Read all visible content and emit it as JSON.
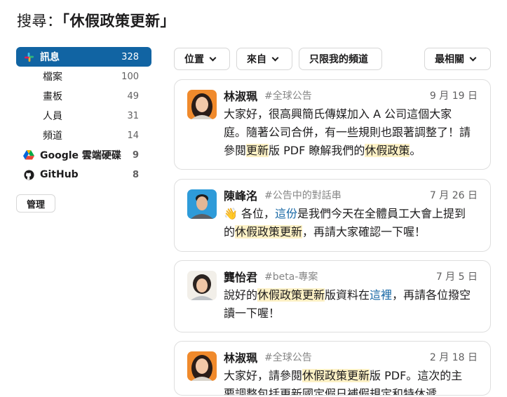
{
  "search": {
    "prefix": "搜尋：",
    "query": "「休假政策更新」"
  },
  "sidebar": {
    "main": {
      "label": "訊息",
      "count": "328"
    },
    "sub_items": [
      {
        "label": "檔案",
        "count": "100"
      },
      {
        "label": "畫板",
        "count": "49"
      },
      {
        "label": "人員",
        "count": "31"
      },
      {
        "label": "頻道",
        "count": "14"
      }
    ],
    "apps": [
      {
        "label": "Google 雲端硬碟",
        "count": "9",
        "icon": "google-drive-icon"
      },
      {
        "label": "GitHub",
        "count": "8",
        "icon": "github-icon"
      }
    ],
    "manage_label": "管理"
  },
  "filters": {
    "location": "位置",
    "from": "來自",
    "my_channels_only": "只限我的頻道",
    "sort": "最相關"
  },
  "results": [
    {
      "author": "林淑珮",
      "channel": "#全球公告",
      "date": "9 月 19 日",
      "segments": [
        {
          "t": "大家好，很高興簡氏傳媒加入 A 公司這個大家庭。隨著公司合併，有一些規則也跟著調整了！請參閱",
          "k": ""
        },
        {
          "t": "更新",
          "k": "hl"
        },
        {
          "t": "版 PDF 瞭解我們的",
          "k": ""
        },
        {
          "t": "休假政策",
          "k": "hl"
        },
        {
          "t": "。",
          "k": ""
        }
      ]
    },
    {
      "author": "陳峰洺",
      "channel": "#公告中的對話串",
      "date": "7 月 26 日",
      "segments": [
        {
          "t": "👋",
          "k": ""
        },
        {
          "t": " 各位，",
          "k": ""
        },
        {
          "t": "這份",
          "k": "link"
        },
        {
          "t": "是我們今天在全體員工大會上提到的",
          "k": ""
        },
        {
          "t": "休假政策更新",
          "k": "hl"
        },
        {
          "t": "，再請大家確認一下喔！",
          "k": ""
        }
      ]
    },
    {
      "author": "龔怡君",
      "channel": "#beta-專案",
      "date": "7 月 5 日",
      "segments": [
        {
          "t": "說好的",
          "k": ""
        },
        {
          "t": "休假政策更新",
          "k": "hl"
        },
        {
          "t": "版資料在",
          "k": ""
        },
        {
          "t": "這裡",
          "k": "link"
        },
        {
          "t": "，再請各位撥空讀一下喔！",
          "k": ""
        }
      ]
    },
    {
      "author": "林淑珮",
      "channel": "#全球公告",
      "date": "2 月 18 日",
      "segments": [
        {
          "t": "大家好，請參閱",
          "k": ""
        },
        {
          "t": "休假政策更新",
          "k": "hl"
        },
        {
          "t": "版 PDF。這次的主要調整包括更新國定假日補假規定和特休遞",
          "k": ""
        }
      ]
    }
  ],
  "colors": {
    "accent": "#1164a3",
    "highlight": "#fdf1c5",
    "link": "#1264a3"
  }
}
